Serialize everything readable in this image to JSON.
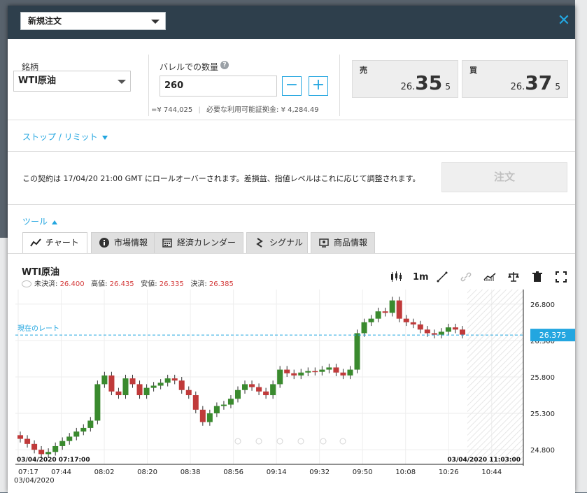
{
  "header": {
    "title": "新規注文"
  },
  "order": {
    "symbol_label": "銘柄",
    "symbol_value": "WTI原油",
    "qty_label": "バレルでの数量",
    "qty_value": "260",
    "help": "?",
    "minus": "−",
    "plus": "+",
    "yen_value": "=¥ 744,025",
    "margin_text": "必要な利用可能証拠金: ¥ 4,284.49"
  },
  "sell": {
    "label": "売",
    "prefix": "26.",
    "big": "35",
    "suffix": "5"
  },
  "buy": {
    "label": "買",
    "prefix": "26.",
    "big": "37",
    "suffix": "5"
  },
  "stop_limit": "ストップ / リミット",
  "notice": "この契約は 17/04/20 21:00 GMT にロールオーバーされます。差損益、指値レベルはこれに応じて調整されます。",
  "order_button": "注文",
  "tools_label": "ツール",
  "tabs": [
    {
      "label": "チャート",
      "icon": "line-chart-icon"
    },
    {
      "label": "市場情報",
      "icon": "info-icon"
    },
    {
      "label": "経済カレンダー",
      "icon": "calendar-icon"
    },
    {
      "label": "シグナル",
      "icon": "signal-icon"
    },
    {
      "label": "商品情報",
      "icon": "product-info-icon"
    }
  ],
  "chart_header": {
    "title": "WTI原油",
    "unsettled_label": "未決済:",
    "unsettled": "26.400",
    "high_label": "高値:",
    "high": "26.435",
    "low_label": "安値:",
    "low": "26.335",
    "settle_label": "決済:",
    "settle": "26.385"
  },
  "toolbar": {
    "interval": "1m"
  },
  "chart_data": {
    "type": "candlestick",
    "title": "WTI原油",
    "current_rate_label": "現在のレート",
    "current_rate": 26.375,
    "ylim": [
      24.6,
      27.0
    ],
    "y_ticks": [
      "26.800",
      "26.300",
      "25.800",
      "25.300",
      "24.800"
    ],
    "x_ticks": [
      "07:17",
      "07:44",
      "08:02",
      "08:20",
      "08:38",
      "08:56",
      "09:14",
      "09:32",
      "09:50",
      "10:08",
      "10:26",
      "10:44"
    ],
    "x_start_date": "03/04/2020",
    "range_start": "03/04/2020 07:17:00",
    "range_end": "03/04/2020 11:03:00",
    "close_series": [
      24.95,
      24.88,
      24.8,
      24.74,
      24.77,
      24.85,
      24.92,
      24.98,
      25.05,
      25.1,
      25.2,
      25.7,
      25.82,
      25.6,
      25.55,
      25.78,
      25.7,
      25.55,
      25.65,
      25.68,
      25.72,
      25.78,
      25.75,
      25.62,
      25.55,
      25.35,
      25.18,
      25.3,
      25.4,
      25.42,
      25.5,
      25.62,
      25.7,
      25.66,
      25.6,
      25.55,
      25.7,
      25.9,
      25.85,
      25.82,
      25.86,
      25.88,
      25.87,
      25.9,
      25.93,
      25.86,
      25.82,
      25.9,
      26.4,
      26.55,
      26.6,
      26.7,
      26.68,
      26.85,
      26.6,
      26.55,
      26.52,
      26.45,
      26.4,
      26.38,
      26.42,
      26.48,
      26.45,
      26.38
    ]
  }
}
